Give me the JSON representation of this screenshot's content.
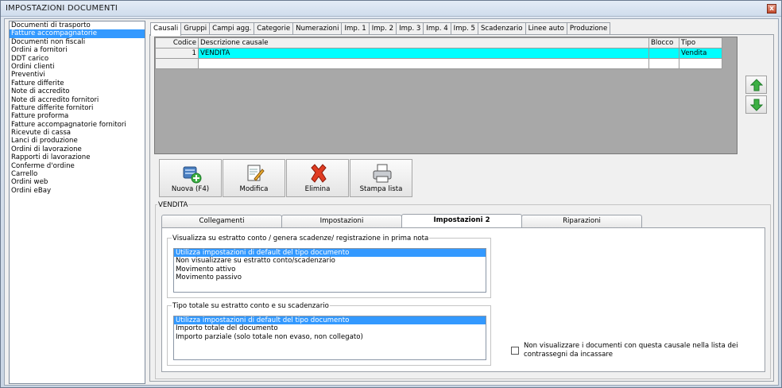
{
  "window": {
    "title": "IMPOSTAZIONI DOCUMENTI",
    "close_glyph": "x"
  },
  "doc_types": [
    "Documenti di trasporto",
    "Fatture accompagnatorie",
    "Documenti non fiscali",
    "Ordini a fornitori",
    "DDT carico",
    "Ordini clienti",
    "Preventivi",
    "Fatture differite",
    "Note di accredito",
    "Note di accredito fornitori",
    "Fatture differite fornitori",
    "Fatture proforma",
    "Fatture accompagnatorie fornitori",
    "Ricevute di cassa",
    "Lanci di produzione",
    "Ordini di lavorazione",
    "Rapporti di lavorazione",
    "Conferme d'ordine",
    "Carrello",
    "Ordini web",
    "Ordini eBay"
  ],
  "doc_types_selected_index": 1,
  "top_tabs": [
    "Causali",
    "Gruppi",
    "Campi agg.",
    "Categorie",
    "Numerazioni",
    "Imp. 1",
    "Imp. 2",
    "Imp. 3",
    "Imp. 4",
    "Imp. 5",
    "Scadenzario",
    "Linee auto",
    "Produzione"
  ],
  "top_tab_active": 0,
  "grid": {
    "headers": {
      "codice": "Codice",
      "descrizione": "Descrizione causale",
      "blocco": "Blocco",
      "tipo": "Tipo"
    },
    "rows": [
      {
        "codice": "1",
        "descrizione": "VENDITA",
        "blocco": "",
        "tipo": "Vendita"
      }
    ]
  },
  "toolbar": {
    "nuova": "Nuova (F4)",
    "modifica": "Modifica",
    "elimina": "Elimina",
    "stampa": "Stampa lista"
  },
  "colors": {
    "selection": "#3399ff",
    "grid_selected": "#00ffff",
    "arrow_green": "#3cb043"
  },
  "detail": {
    "group_label": "VENDITA",
    "tabs": [
      "Collegamenti",
      "Impostazioni",
      "Impostazioni 2",
      "Riparazioni"
    ],
    "active_tab": 2,
    "frame1": {
      "label": "Visualizza su estratto conto / genera scadenze/ registrazione  in prima nota",
      "options": [
        "Utilizza impostazioni di default del tipo documento",
        "Non visualizzare su estratto conto/scadenzario",
        "Movimento attivo",
        "Movimento passivo"
      ],
      "selected": 0
    },
    "frame2": {
      "label": "Tipo totale su estratto conto e su scadenzario",
      "options": [
        "Utilizza impostazioni di default del tipo documento",
        "Importo totale del documento",
        "Importo parziale (solo totale non evaso, non collegato)"
      ],
      "selected": 0
    },
    "checkbox_label": "Non visualizzare i documenti con questa causale nella lista dei contrassegni da incassare",
    "checkbox_checked": false
  }
}
